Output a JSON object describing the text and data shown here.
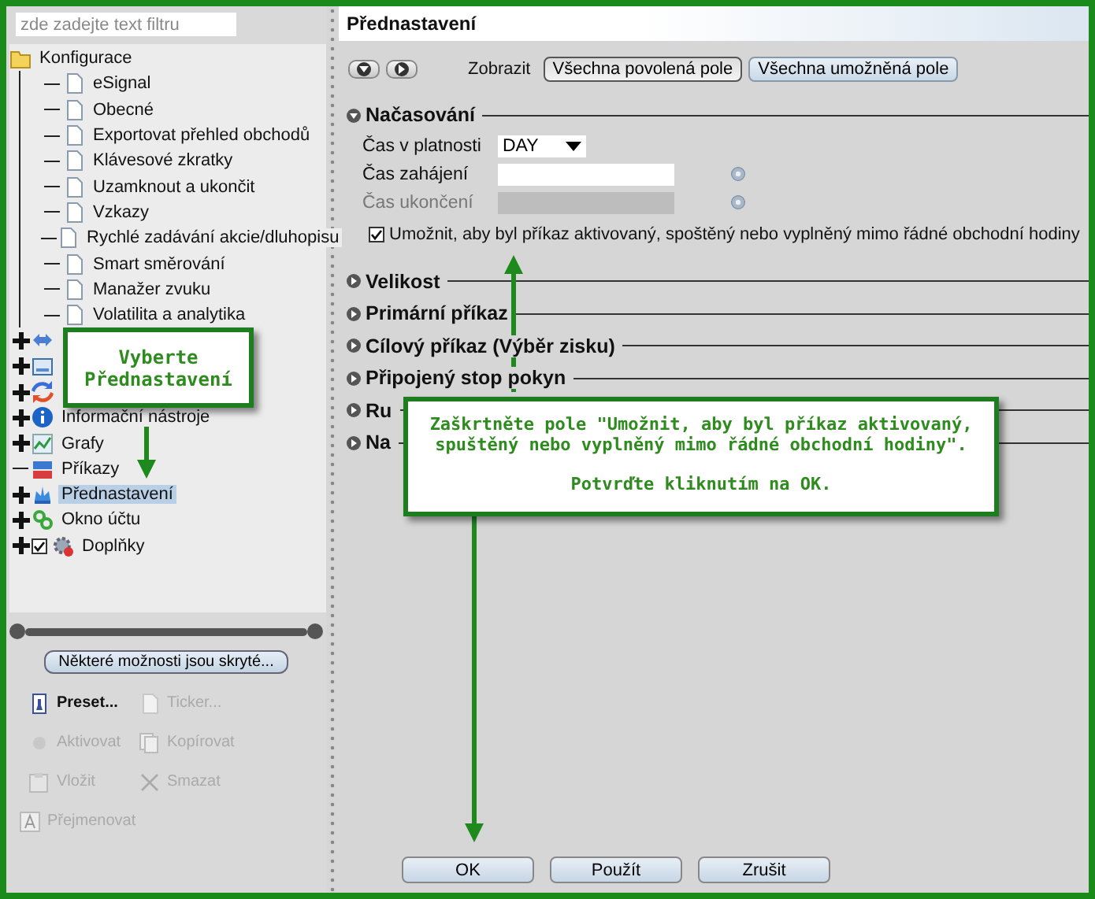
{
  "filter": {
    "placeholder": "zde zadejte text filtru"
  },
  "tree": [
    {
      "label": "Konfigurace",
      "expandable": false,
      "selected": false,
      "children": [
        {
          "label": "eSignal",
          "selected": false
        },
        {
          "label": "Obecné",
          "selected": false
        },
        {
          "label": "Exportovat přehled obchodů",
          "selected": false
        },
        {
          "label": "Klávesové zkratky",
          "selected": false
        },
        {
          "label": "Uzamknout a ukončit",
          "selected": false
        },
        {
          "label": "Vzkazy",
          "selected": false
        },
        {
          "label": "Rychlé zadávání akcie/dluhopisu",
          "selected": false
        },
        {
          "label": "Smart směrování",
          "selected": false
        },
        {
          "label": "Manažer zvuku",
          "selected": false
        },
        {
          "label": "Volatilita a analytika",
          "selected": false
        }
      ]
    },
    {
      "expandable": true,
      "selected": false
    },
    {
      "expandable": true,
      "selected": false
    },
    {
      "expandable": true,
      "selected": false
    },
    {
      "label": "Informační nástroje",
      "expandable": true,
      "selected": false
    },
    {
      "label": "Grafy",
      "expandable": true,
      "selected": false
    },
    {
      "label": "Příkazy",
      "expandable": false,
      "selected": false
    },
    {
      "label": "Přednastavení",
      "expandable": true,
      "selected": true
    },
    {
      "label": "Okno účtu",
      "expandable": true,
      "selected": false
    },
    {
      "label": "Doplňky",
      "expandable": true,
      "selected": false,
      "checked": true
    }
  ],
  "hidden_options_button": "Některé možnosti jsou skryté...",
  "actions": [
    {
      "label": "Preset...",
      "disabled": false
    },
    {
      "label": "Ticker...",
      "disabled": true
    },
    {
      "label": "Aktivovat",
      "disabled": true
    },
    {
      "label": "Kopírovat",
      "disabled": true
    },
    {
      "label": "Vložit",
      "disabled": true
    },
    {
      "label": "Smazat",
      "disabled": true
    },
    {
      "label": "Přejmenovat",
      "disabled": true
    }
  ],
  "panel": {
    "title": "Přednastavení",
    "show_label": "Zobrazit",
    "views": [
      {
        "label": "Všechna povolená pole",
        "selected": true
      },
      {
        "label": "Všechna umožněná pole",
        "selected": false
      }
    ],
    "sections": [
      {
        "title": "Načasování",
        "expanded": true,
        "fields": [
          {
            "label": "Čas v platnosti",
            "kind": "select",
            "value": "DAY",
            "disabled": false
          },
          {
            "label": "Čas zahájení",
            "kind": "text",
            "disabled": false
          },
          {
            "label": "Čas ukončení",
            "kind": "text",
            "disabled": true
          }
        ],
        "options": [
          {
            "label": "Umožnit, aby byl příkaz aktivovaný, spoštěný nebo vyplněný mimo řádné obchodní hodiny",
            "checked": true
          }
        ]
      },
      {
        "title": "Velikost",
        "expanded": false
      },
      {
        "title": "Primární příkaz",
        "expanded": false
      },
      {
        "title": "Cílový příkaz (Výběr zisku)",
        "expanded": false
      },
      {
        "title": "Připojený stop pokyn",
        "expanded": false
      },
      {
        "title": "Ru",
        "expanded": false
      },
      {
        "title": "Na",
        "expanded": false
      }
    ],
    "buttons": [
      "OK",
      "Použít",
      "Zrušit"
    ]
  },
  "callouts": [
    {
      "text": "Vyberte Přednastavení"
    },
    {
      "paragraphs": [
        "Zaškrtněte pole \"Umožnit, aby byl příkaz aktivovaný, spuštěný nebo vyplněný  mimo řádné obchodní hodiny\".",
        "Potvrďte kliknutím na OK."
      ]
    }
  ]
}
